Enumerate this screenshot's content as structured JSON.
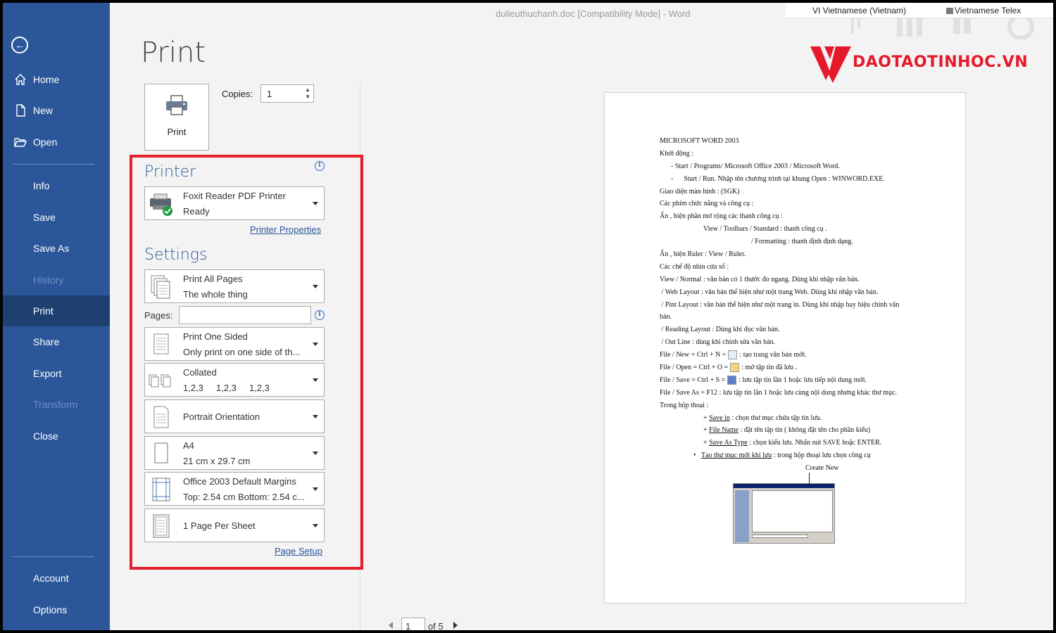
{
  "window": {
    "title": "dulieuthuchanh.doc [Compatibility Mode]  -  Word",
    "lang_input": "VI  Vietnamese (Vietnam)",
    "lang_method": "Vietnamese Telex"
  },
  "logo": {
    "text": "DAOTAOTINHOC.VN",
    "color": "#e6192a"
  },
  "sidebar": {
    "back_icon": "back-arrow-icon",
    "items": [
      {
        "label": "Home",
        "icon": "home-icon"
      },
      {
        "label": "New",
        "icon": "new-document-icon"
      },
      {
        "label": "Open",
        "icon": "folder-open-icon"
      },
      {
        "label": "Info"
      },
      {
        "label": "Save"
      },
      {
        "label": "Save As"
      },
      {
        "label": "History"
      },
      {
        "label": "Print"
      },
      {
        "label": "Share"
      },
      {
        "label": "Export"
      },
      {
        "label": "Transform"
      },
      {
        "label": "Close"
      },
      {
        "label": "Account"
      },
      {
        "label": "Options"
      }
    ],
    "active": "Print",
    "disabled": [
      "History",
      "Transform"
    ],
    "colors": {
      "background": "#2b579a",
      "active": "#1e4070"
    }
  },
  "print": {
    "title": "Print",
    "button_label": "Print",
    "copies_label": "Copies:",
    "copies_value": "1"
  },
  "printer": {
    "section_title": "Printer",
    "name": "Foxit Reader PDF Printer",
    "status": "Ready",
    "properties_link": "Printer Properties"
  },
  "settings": {
    "section_title": "Settings",
    "pages_label": "Pages:",
    "pages_value": "",
    "page_range": {
      "line1": "Print All Pages",
      "line2": "The whole thing"
    },
    "sides": {
      "line1": "Print One Sided",
      "line2": "Only print on one side of th..."
    },
    "collation": {
      "line1": "Collated",
      "line2": "1,2,3     1,2,3     1,2,3"
    },
    "orientation": {
      "line1": "Portrait Orientation"
    },
    "paper": {
      "line1": "A4",
      "line2": "21 cm x 29.7 cm"
    },
    "margins": {
      "line1": "Office 2003 Default Margins",
      "line2": "Top: 2.54 cm Bottom: 2.54 c..."
    },
    "per_sheet": {
      "line1": "1 Page Per Sheet"
    },
    "page_setup_link": "Page Setup"
  },
  "preview": {
    "page_current": "1",
    "page_total": "of 5",
    "lines": [
      "MICROSOFT WORD 2003",
      "Khởi động :",
      "-      Start / Programs/ Microsoft Office 2003 / Microsoft Word.",
      "-      Start / Run. Nhập tên chương trình tại khung Open : WINWORD.EXE.",
      "Giao diện màn hình : (SGK)",
      "Các phím chức năng và công cụ :",
      "Ẩn , hiện phần mở rộng các thanh công cụ :",
      "View / Toolbars / Standard : thanh công cụ .",
      "/ Formatting : thanh định định dạng.",
      "Ẩn , hiện  Ruler : View / Ruler.",
      "Các chế độ nhìn cửa sổ :",
      "View / Normal : văn bản có 1 thước đo ngang. Dùng khi nhập văn bản.",
      " / Web Layout : văn bản thể hiện như một trang Web. Dùng khi nhập văn bản.",
      " / Pint Layout : văn bản thể hiện như một trang in. Dùng khi nhập hay hiệu chỉnh văn",
      "bản.",
      " / Reading Layout : Dùng khi đọc văn bản.",
      " / Out Line : dùng khi chỉnh sửa văn bản.",
      "File / New = Ctrl + N =",
      ": tạo trang văn bản mới.",
      "File / Open = Ctrl + O =",
      ": mở tập tin đã lưu .",
      "File / Save = Ctrl + S =",
      ": lưu  tập tin lần 1 hoặc lưu tiếp nội dung mới.",
      "File / Save As = F12 : lưu tập tin lần 1 hoặc lưu cùng nội dung nhưng khác thư mục.",
      "Trong hộp thoại :",
      "+ ",
      "Save in",
      " : chọn thư mục chứa tập tin lưu.",
      "File Name",
      " : đặt tên tập tin ( không đặt tên cho phần kiểu)",
      "Save As Type",
      " : chọn kiểu lưu. Nhấn nút SAVE hoặc ENTER.",
      "Tạo thư mục mới khi lưu",
      " : trong hộp thoại lưu chọn công cụ",
      "Create New"
    ]
  },
  "colors": {
    "accent": "#2b579a",
    "highlight": "#e3202b",
    "ok_badge": "#1e9a3a"
  }
}
